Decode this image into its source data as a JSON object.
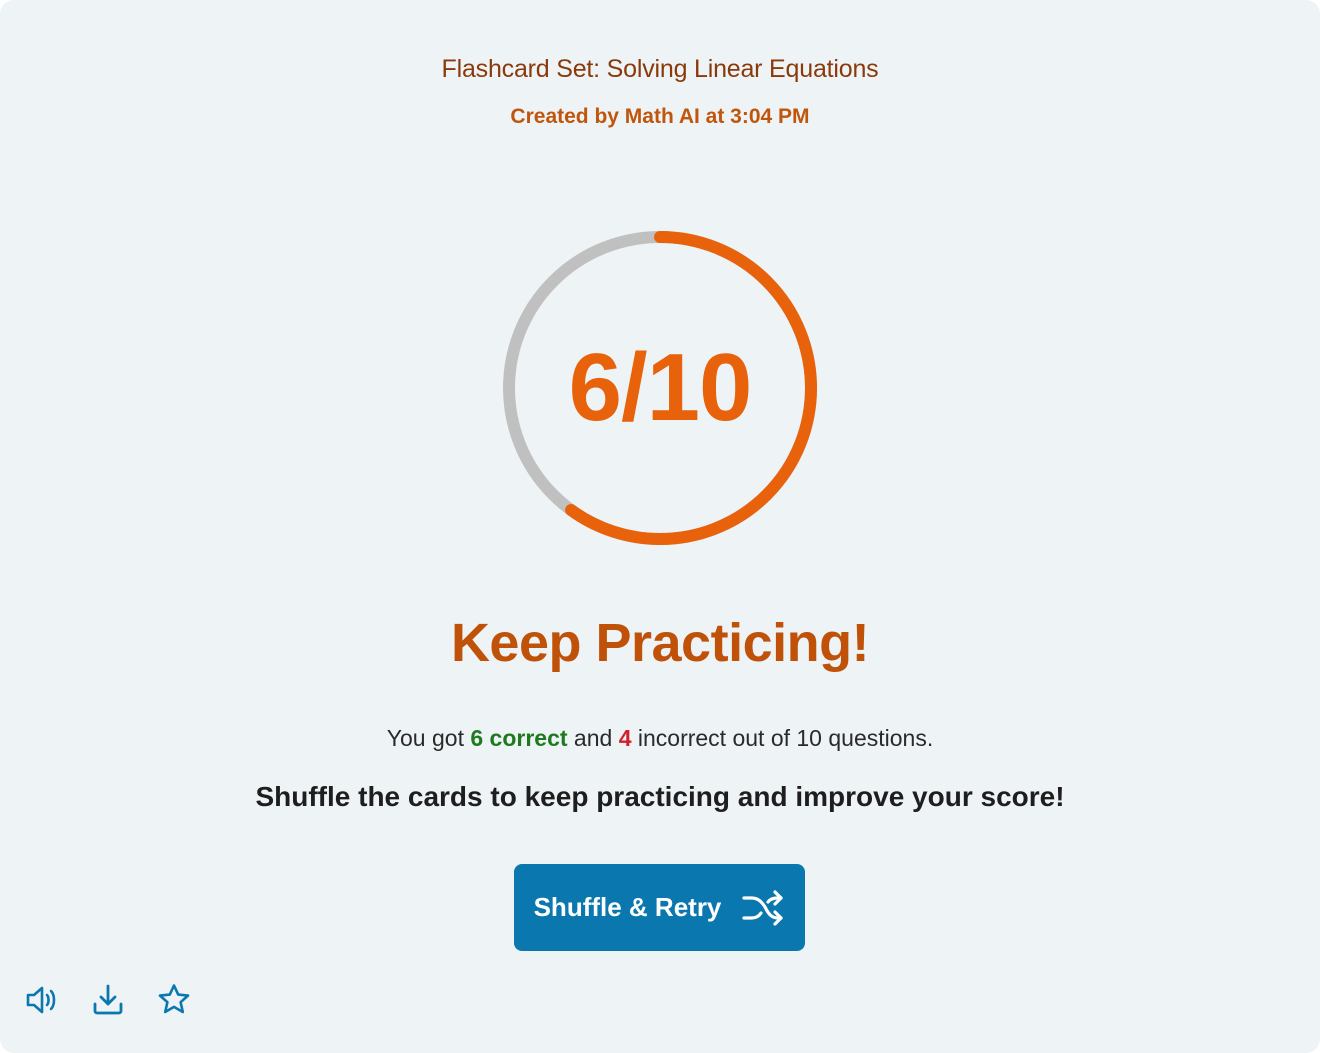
{
  "header": {
    "set_title": "Flashcard Set: Solving Linear Equations",
    "created": "Created by Math AI at 3:04 PM"
  },
  "result": {
    "score_label": "6/10",
    "correct": 6,
    "total": 10,
    "fraction": 0.6,
    "headline": "Keep Practicing!"
  },
  "summary": {
    "prefix": "You got ",
    "correct_text": "6 correct",
    "middle": " and ",
    "incorrect_text": "4",
    "suffix": " incorrect out of 10 questions."
  },
  "encouragement": "Shuffle the cards to keep practicing and improve your score!",
  "actions": {
    "retry_label": "Shuffle & Retry",
    "retry_icon": "shuffle-icon"
  },
  "toolbar": {
    "icons": [
      "speaker-icon",
      "download-icon",
      "star-icon"
    ]
  },
  "colors": {
    "accent": "#e8620c",
    "track": "#c0c0c0",
    "button": "#0a78ae",
    "correct": "#1f7a1f",
    "incorrect": "#d0202a",
    "icon": "#0a78ae"
  }
}
